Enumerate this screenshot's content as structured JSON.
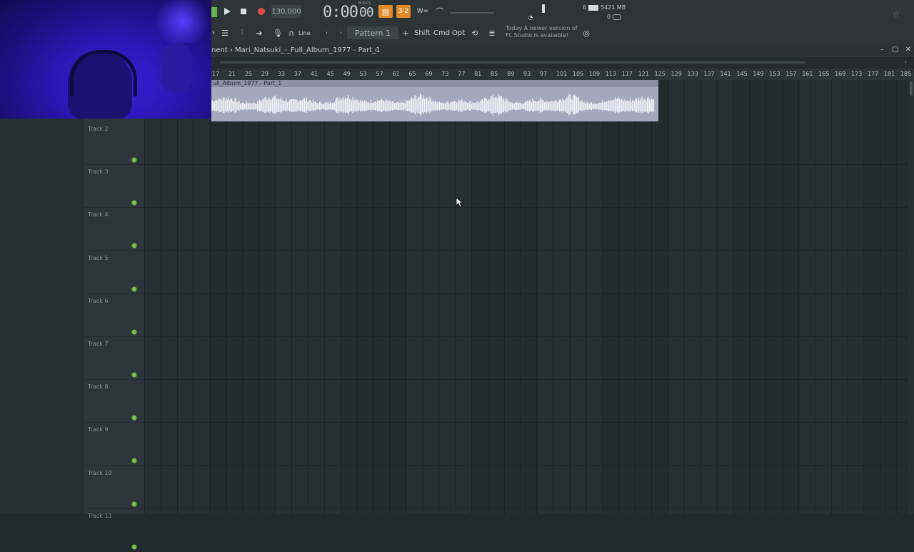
{
  "toolbar": {
    "tempo": "130.000",
    "time": "0:00",
    "time_small": "00",
    "time_label": "M:S:CS",
    "snap_label": "Line",
    "pattern_label": "Pattern 1",
    "shift_label": "Shift",
    "cmd_label": "Cmd",
    "opt_label": "Opt",
    "memory": "5421 MB",
    "cpu_value": "6",
    "poly_value": "0",
    "hint_line1": "Today  A newer version of",
    "hint_line2": "FL Studio is available!",
    "accent_color": "#e08a2a"
  },
  "breadcrumb": {
    "prefix": "nent",
    "path": "Mari_Natsuki_-_Full_Album_1977 - Part_1"
  },
  "ruler": {
    "bars": [
      "17",
      "21",
      "25",
      "29",
      "33",
      "37",
      "41",
      "45",
      "49",
      "53",
      "57",
      "61",
      "65",
      "69",
      "73",
      "77",
      "81",
      "85",
      "89",
      "93",
      "97",
      "101",
      "105",
      "109",
      "113",
      "117",
      "121",
      "125",
      "129",
      "133",
      "137",
      "141",
      "145",
      "149",
      "153",
      "157",
      "161",
      "165",
      "169",
      "173",
      "177",
      "181",
      "185"
    ]
  },
  "clip": {
    "title": "ull_Album_1977 - Part_1",
    "color": "#c3c6d4"
  },
  "tracks": [
    {
      "label": "Track 2"
    },
    {
      "label": "Track 3"
    },
    {
      "label": "Track 4"
    },
    {
      "label": "Track 5"
    },
    {
      "label": "Track 6"
    },
    {
      "label": "Track 7"
    },
    {
      "label": "Track 8"
    },
    {
      "label": "Track 9"
    },
    {
      "label": "Track 10"
    },
    {
      "label": "Track 11"
    }
  ]
}
